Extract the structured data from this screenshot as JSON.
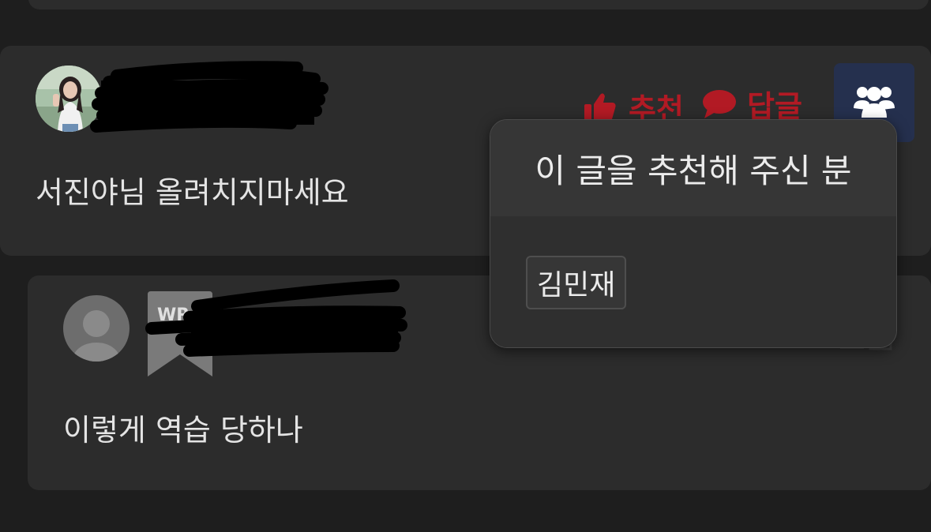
{
  "comments": [
    {
      "text": "서진야님 올려치지마세요",
      "actions": {
        "recommend_label": "추천",
        "reply_label": "답글"
      }
    },
    {
      "text": "이렇게 역습 당하나"
    }
  ],
  "popup": {
    "title": "이 글을 추천해 주신 분",
    "recommenders": [
      "김민재"
    ]
  },
  "badge": {
    "text": "WR"
  },
  "colors": {
    "background": "#1e1e1e",
    "card": "#2c2c2c",
    "accent_red": "#b21a24",
    "recommenders_button": "#25304e"
  },
  "icons": {
    "recommend": "thumbs-up-icon",
    "reply": "speech-bubble-icon",
    "recommenders": "users-group-icon",
    "default_avatar": "user-silhouette-icon"
  }
}
